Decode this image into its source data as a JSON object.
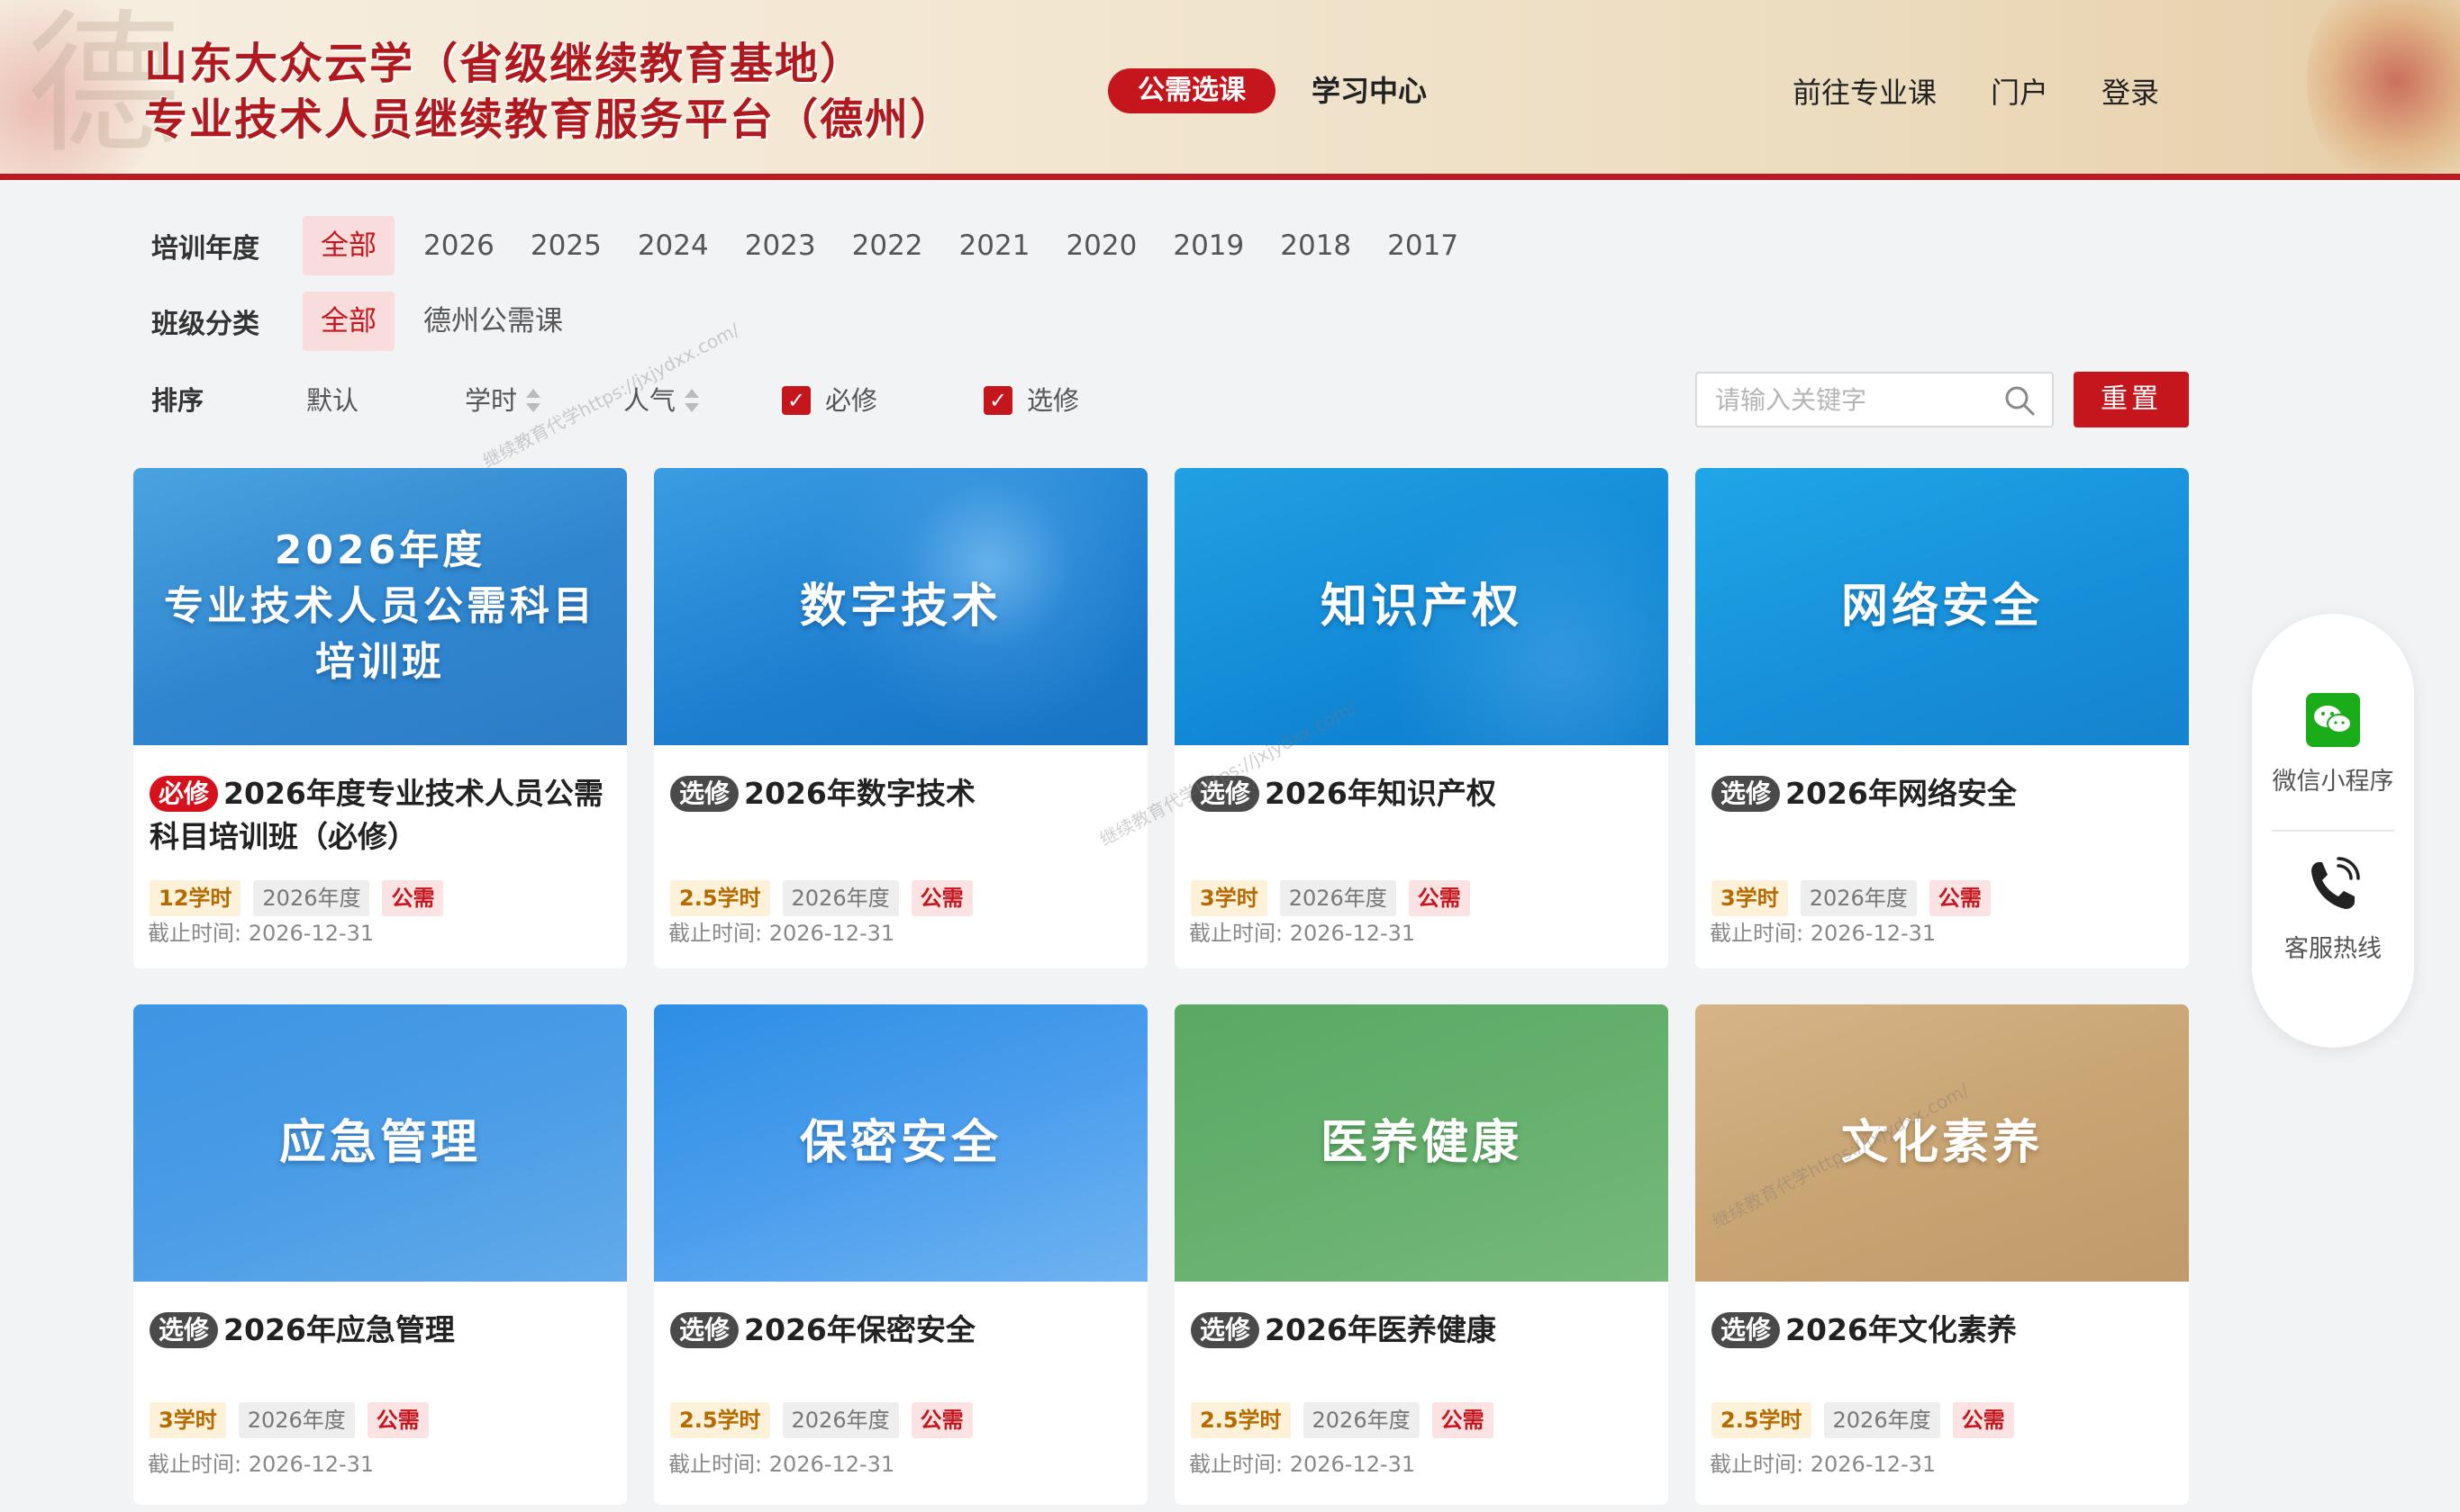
{
  "header": {
    "brand_line1": "山东大众云学（省级继续教育基地）",
    "brand_line2": "专业技术人员继续教育服务平台（德州）",
    "nav_active": "公需选课",
    "nav_study": "学习中心",
    "nav_right": [
      "前往专业课",
      "门户",
      "登录"
    ]
  },
  "filters": {
    "year_label": "培训年度",
    "year_options": [
      "全部",
      "2026",
      "2025",
      "2024",
      "2023",
      "2022",
      "2021",
      "2020",
      "2019",
      "2018",
      "2017"
    ],
    "class_label": "班级分类",
    "class_options": [
      "全部",
      "德州公需课"
    ],
    "sort_label": "排序",
    "sort_default": "默认",
    "sort_hours": "学时",
    "sort_popular": "人气",
    "check_required": "必修",
    "check_optional": "选修",
    "search_placeholder": "请输入关键字",
    "reset_label": "重置"
  },
  "courses": [
    {
      "banner": "2026年度\n专业技术人员公需科目\n培训班",
      "badge": "必修",
      "title": "2026年度专业技术人员公需科目培训班（必修）",
      "hours": "12学时",
      "year": "2026年度",
      "type": "公需",
      "deadline": "截止时间: 2026-12-31"
    },
    {
      "banner": "数字技术",
      "badge": "选修",
      "title": "2026年数字技术",
      "hours": "2.5学时",
      "year": "2026年度",
      "type": "公需",
      "deadline": "截止时间: 2026-12-31"
    },
    {
      "banner": "知识产权",
      "badge": "选修",
      "title": "2026年知识产权",
      "hours": "3学时",
      "year": "2026年度",
      "type": "公需",
      "deadline": "截止时间: 2026-12-31"
    },
    {
      "banner": "网络安全",
      "badge": "选修",
      "title": "2026年网络安全",
      "hours": "3学时",
      "year": "2026年度",
      "type": "公需",
      "deadline": "截止时间: 2026-12-31"
    },
    {
      "banner": "应急管理",
      "badge": "选修",
      "title": "2026年应急管理",
      "hours": "3学时",
      "year": "2026年度",
      "type": "公需",
      "deadline": "截止时间: 2026-12-31"
    },
    {
      "banner": "保密安全",
      "badge": "选修",
      "title": "2026年保密安全",
      "hours": "2.5学时",
      "year": "2026年度",
      "type": "公需",
      "deadline": "截止时间: 2026-12-31"
    },
    {
      "banner": "医养健康",
      "badge": "选修",
      "title": "2026年医养健康",
      "hours": "2.5学时",
      "year": "2026年度",
      "type": "公需",
      "deadline": "截止时间: 2026-12-31"
    },
    {
      "banner": "文化素养",
      "badge": "选修",
      "title": "2026年文化素养",
      "hours": "2.5学时",
      "year": "2026年度",
      "type": "公需",
      "deadline": "截止时间: 2026-12-31"
    }
  ],
  "side_panel": {
    "wechat_label": "微信小程序",
    "hotline_label": "客服热线"
  },
  "watermark_text": "继续教育代学https://jxjydxx.com/",
  "colors": {
    "brand_red": "#c4161c",
    "required_badge": "#d7111b",
    "optional_badge": "#4a4a4a",
    "page_bg": "#f2f3f5"
  }
}
